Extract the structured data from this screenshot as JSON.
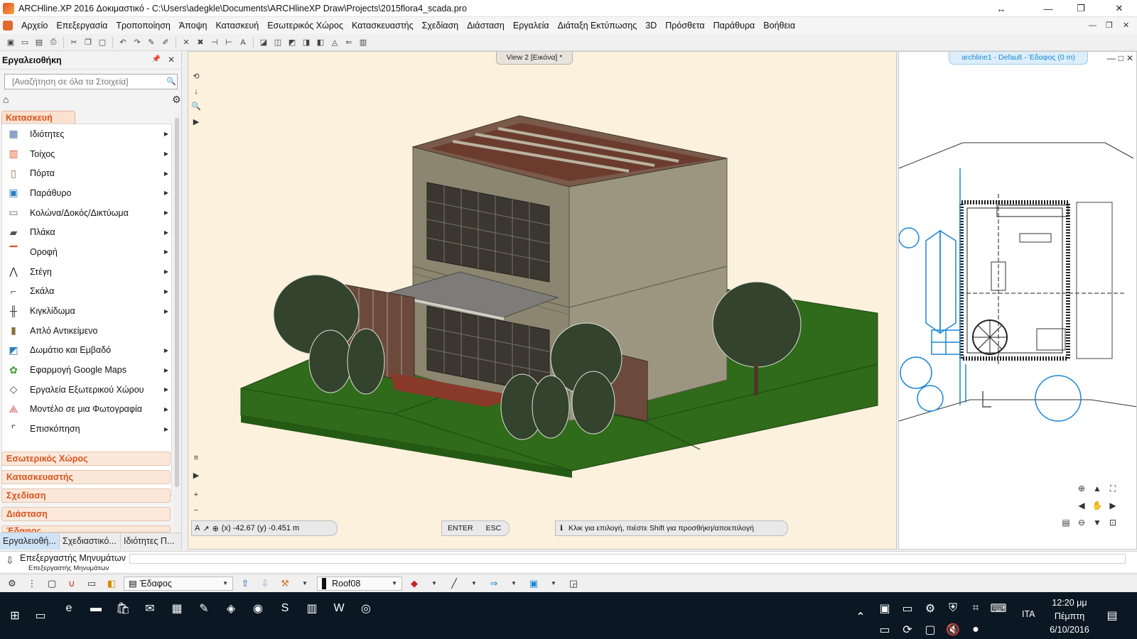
{
  "window": {
    "title": "ARCHline.XP 2016 Δοκιμαστικό - C:\\Users\\adegkle\\Documents\\ARCHlineXP Draw\\Projects\\2015flora4_scada.pro"
  },
  "menu": [
    "Αρχείο",
    "Επεξεργασία",
    "Τροποποίηση",
    "Άποψη",
    "Κατασκευή",
    "Εσωτερικός Χώρος",
    "Κατασκευαστής",
    "Σχεδίαση",
    "Διάσταση",
    "Εργαλεία",
    "Διάταξη Εκτύπωσης",
    "3D",
    "Πρόσθετα",
    "Παράθυρα",
    "Βοήθεια"
  ],
  "left_panel": {
    "title": "Εργαλειοθήκη",
    "search_placeholder": "[Αναζήτηση σε όλα τα Στοιχεία]",
    "active_category": "Κατασκευή",
    "items": [
      {
        "label": "Ιδιότητες",
        "icon": "properties-icon",
        "arrow": true
      },
      {
        "label": "Τοίχος",
        "icon": "wall-icon",
        "arrow": true
      },
      {
        "label": "Πόρτα",
        "icon": "door-icon",
        "arrow": true
      },
      {
        "label": "Παράθυρο",
        "icon": "window-icon",
        "arrow": true
      },
      {
        "label": "Κολώνα/Δοκός/Δικτύωμα",
        "icon": "column-icon",
        "arrow": true
      },
      {
        "label": "Πλάκα",
        "icon": "slab-icon",
        "arrow": true
      },
      {
        "label": "Οροφή",
        "icon": "ceiling-icon",
        "arrow": true
      },
      {
        "label": "Στέγη",
        "icon": "roof-icon",
        "arrow": true
      },
      {
        "label": "Σκάλα",
        "icon": "stair-icon",
        "arrow": true
      },
      {
        "label": "Κιγκλίδωμα",
        "icon": "railing-icon",
        "arrow": true
      },
      {
        "label": "Απλό Αντικείμενο",
        "icon": "object-icon",
        "arrow": false
      },
      {
        "label": "Δωμάτιο και Εμβαδό",
        "icon": "room-area-icon",
        "arrow": true
      },
      {
        "label": "Εφαρμογή Google Maps",
        "icon": "google-maps-icon",
        "arrow": true
      },
      {
        "label": "Εργαλεία Εξωτερικού Χώρου",
        "icon": "landscape-icon",
        "arrow": true
      },
      {
        "label": "Μοντέλο σε μια Φωτογραφία",
        "icon": "photo-model-icon",
        "arrow": true
      },
      {
        "label": "Επισκόπηση",
        "icon": "overview-icon",
        "arrow": true
      }
    ],
    "categories": [
      "Εσωτερικός Χώρος",
      "Κατασκευαστής",
      "Σχεδίαση",
      "Διάσταση",
      "Έδαφος"
    ],
    "tabs": [
      "Εργαλειοθή...",
      "Σχεδιαστικό...",
      "Ιδιότητες Π..."
    ]
  },
  "main_view": {
    "tab_label": "View 2 [Εικόνα] *",
    "coords": "(x) -42.67  (y) -0.451 m",
    "enter_label": "ENTER",
    "esc_label": "ESC",
    "hint": "Κλικ για επιλογή, πιέστε Shift για προσθήκη/αποεπιλογή"
  },
  "plan_view": {
    "tab_label": "archline1 - Default - Έδαφος (0 m)"
  },
  "message_bar": {
    "label": "Επεξεργαστής Μηνυμάτων",
    "sublabel": "Επεξεργαστής Μηνυμάτων"
  },
  "bottom_bar": {
    "layer": "Έδαφος",
    "roof": "Roof08"
  },
  "taskbar": {
    "time": "12:20 μμ",
    "day": "Πέμπτη",
    "date": "6/10/2016",
    "lang": "ITA"
  },
  "colors": {
    "accent_orange": "#d9541e",
    "plan_blue": "#1a86d6",
    "ground_green": "#2f6b1a",
    "taskbar": "#0b1722"
  }
}
